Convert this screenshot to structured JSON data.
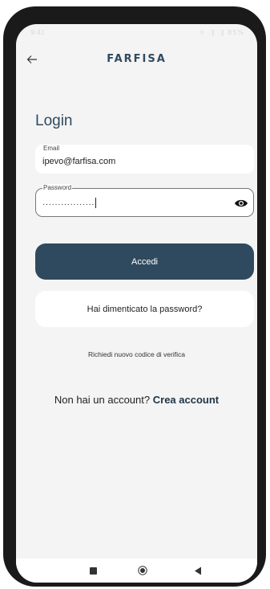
{
  "status_bar": {
    "time": "9:41",
    "indicators": "☼ .∥ .∥ 85%"
  },
  "header": {
    "brand": "FARFISA",
    "back_icon": "arrow-left-icon"
  },
  "login": {
    "title": "Login",
    "email": {
      "label": "Email",
      "value": "ipevo@farfisa.com"
    },
    "password": {
      "label": "Password",
      "value": "·················",
      "toggle_icon": "eye-icon"
    },
    "submit_label": "Accedi",
    "forgot_label": "Hai dimenticato la password?",
    "request_code_label": "Richiedi nuovo codice di verifica",
    "no_account_text": "Non hai un account?",
    "create_account_label": "Crea account"
  },
  "colors": {
    "primary": "#2f4a5f",
    "background": "#f4f4f4",
    "surface": "#ffffff"
  },
  "nav_bar": {
    "icons": [
      "recent-apps-icon",
      "home-icon",
      "back-icon"
    ]
  }
}
